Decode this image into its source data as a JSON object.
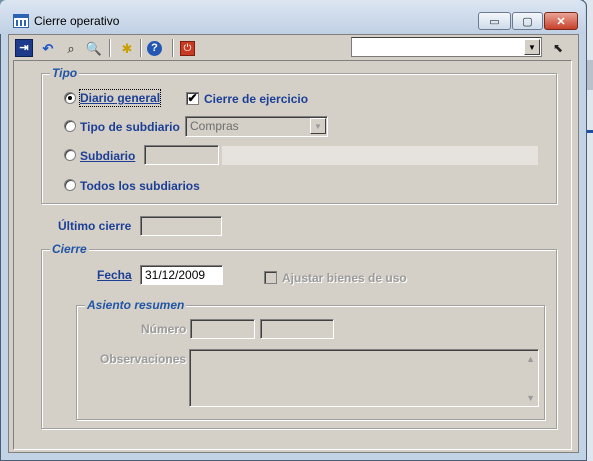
{
  "window": {
    "title": "Cierre operativo",
    "min_glyph": "▭",
    "max_glyph": "▢",
    "close_glyph": "✕"
  },
  "toolbar": {
    "icons": {
      "exit": "⇥",
      "undo": "↶",
      "find": "⌕",
      "zoom": "🔍",
      "new": "✱",
      "help": "?",
      "power": "⏻",
      "tool": "⬉"
    },
    "combo_value": "",
    "combo_arrow": "▼"
  },
  "tipo": {
    "legend": "Tipo",
    "diario_general": {
      "label": "Diario general",
      "selected": true
    },
    "cierre_ejercicio": {
      "label": "Cierre de ejercicio",
      "checked": true,
      "check_glyph": "✔"
    },
    "tipo_subdiario": {
      "label": "Tipo de subdiario",
      "selected": false,
      "value": "Compras",
      "arrow": "▼"
    },
    "subdiario": {
      "label": "Subdiario",
      "selected": false,
      "code": "",
      "name": ""
    },
    "todos": {
      "label": "Todos los subdiarios",
      "selected": false
    }
  },
  "ultimo_cierre": {
    "label": "Último cierre",
    "value": ""
  },
  "cierre": {
    "legend": "Cierre",
    "fecha": {
      "label": "Fecha",
      "value": "31/12/2009"
    },
    "ajustar": {
      "label": "Ajustar bienes de uso",
      "checked": false
    },
    "asiento": {
      "legend": "Asiento resumen",
      "numero": {
        "label": "Número",
        "value1": "",
        "value2": ""
      },
      "observaciones": {
        "label": "Observaciones",
        "value": "",
        "up": "▲",
        "down": "▼"
      }
    }
  }
}
